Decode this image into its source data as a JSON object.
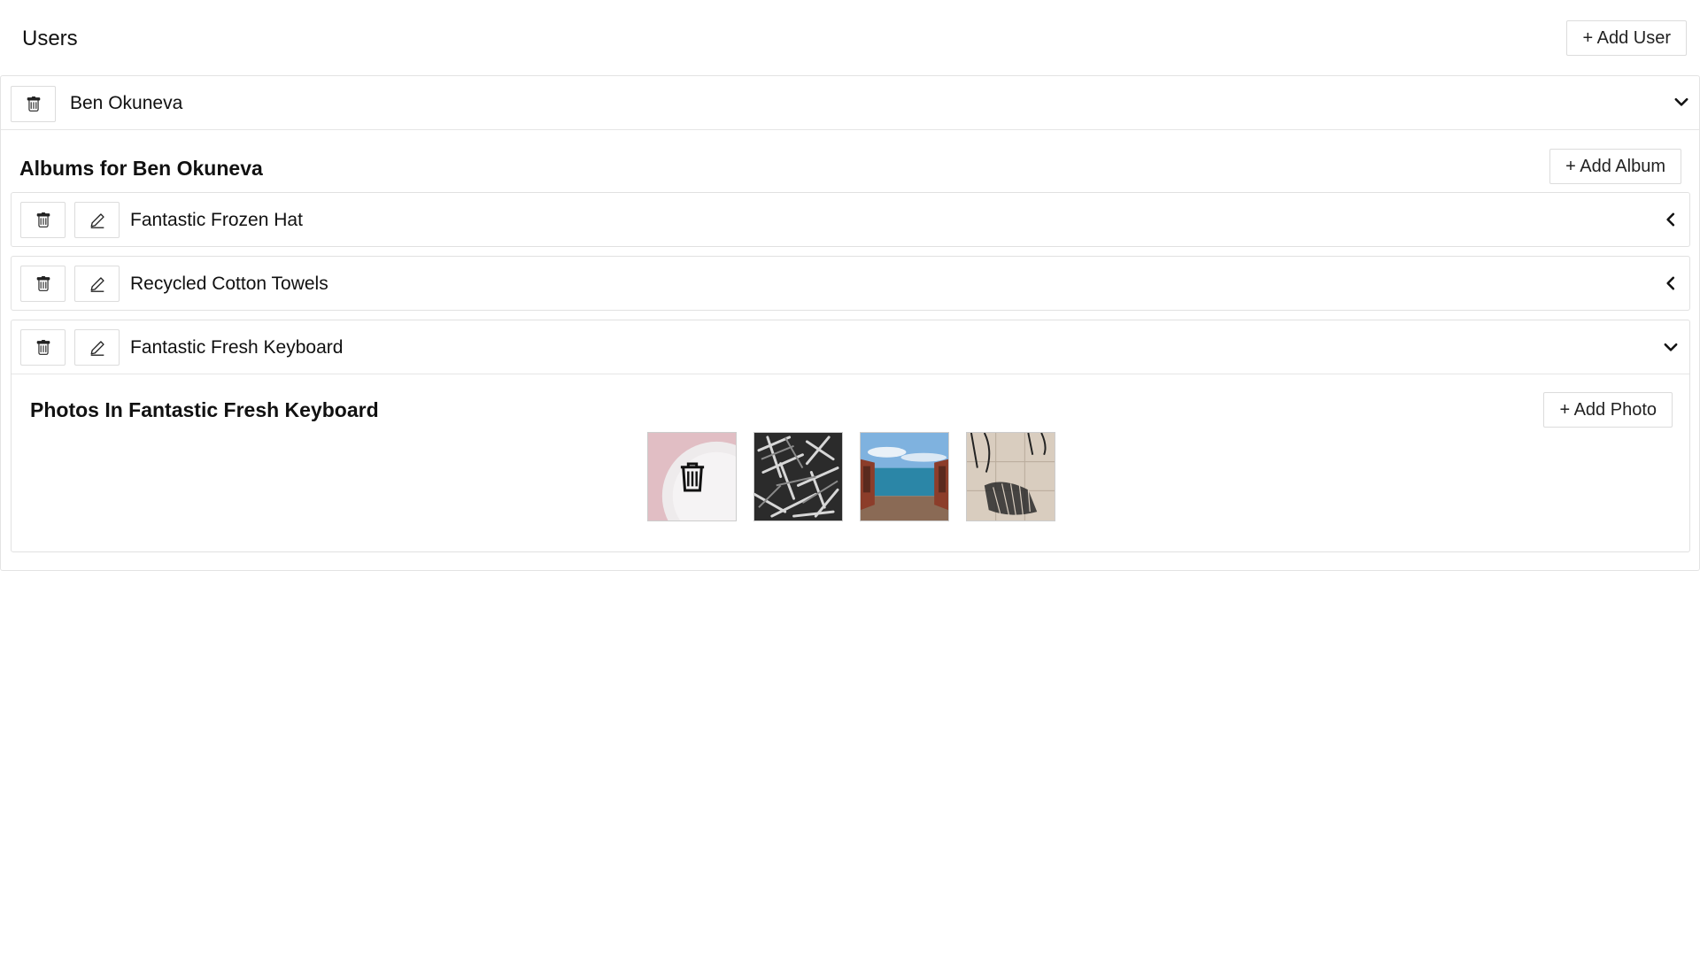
{
  "header": {
    "title": "Users",
    "add_user_label": "+ Add User"
  },
  "user": {
    "name": "Ben Okuneva",
    "albums_title": "Albums for Ben Okuneva",
    "add_album_label": "+ Add Album",
    "albums": [
      {
        "name": "Fantastic Frozen Hat",
        "expanded": false
      },
      {
        "name": "Recycled Cotton Towels",
        "expanded": false
      },
      {
        "name": "Fantastic Fresh Keyboard",
        "expanded": true
      }
    ]
  },
  "photos": {
    "title": "Photos In Fantastic Fresh Keyboard",
    "add_photo_label": "+ Add Photo",
    "items": [
      {
        "subject": "pink plate",
        "hovered": true
      },
      {
        "subject": "paperclips"
      },
      {
        "subject": "sea view"
      },
      {
        "subject": "chair shadow"
      }
    ]
  },
  "icons": {
    "delete": "trash-icon",
    "edit": "pencil-icon",
    "expanded": "chevron-down-icon",
    "collapsed": "chevron-left-icon"
  }
}
